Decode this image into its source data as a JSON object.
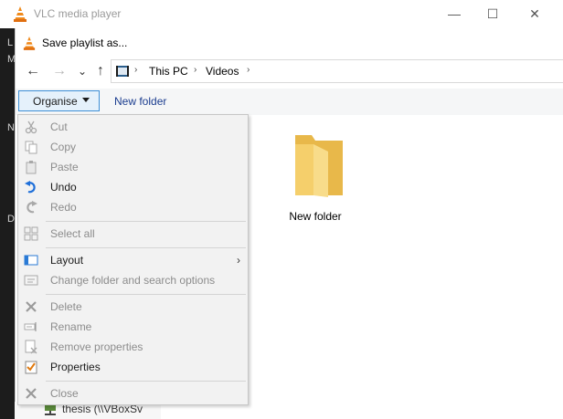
{
  "vlc": {
    "title": "VLC media player",
    "controls": {
      "minimize": "—",
      "maximize": "☐",
      "close": "✕"
    },
    "left_fragments": [
      "L",
      "M",
      "N",
      "D"
    ],
    "tree_item": "thesis (\\\\VBoxSv"
  },
  "dialog": {
    "title": "Save playlist as...",
    "nav": {
      "back": "←",
      "forward": "→",
      "recent": "⌄",
      "up": "↑"
    },
    "breadcrumb": {
      "sep": "›",
      "items": [
        "This PC",
        "Videos"
      ]
    },
    "toolbar": {
      "organise_label": "Organise",
      "new_folder_label": "New folder"
    },
    "folder_label": "New folder"
  },
  "menu": {
    "items": [
      {
        "label": "Cut",
        "enabled": false,
        "icon": "cut-icon"
      },
      {
        "label": "Copy",
        "enabled": false,
        "icon": "copy-icon"
      },
      {
        "label": "Paste",
        "enabled": false,
        "icon": "paste-icon"
      },
      {
        "label": "Undo",
        "enabled": true,
        "icon": "undo-icon"
      },
      {
        "label": "Redo",
        "enabled": false,
        "icon": "redo-icon"
      },
      {
        "label": "Select all",
        "enabled": false,
        "icon": "select-all-icon"
      },
      {
        "label": "Layout",
        "enabled": true,
        "icon": "layout-icon",
        "submenu": true
      },
      {
        "label": "Change folder and search options",
        "enabled": false,
        "icon": "options-icon"
      },
      {
        "label": "Delete",
        "enabled": false,
        "icon": "delete-icon"
      },
      {
        "label": "Rename",
        "enabled": false,
        "icon": "rename-icon"
      },
      {
        "label": "Remove properties",
        "enabled": false,
        "icon": "remove-properties-icon"
      },
      {
        "label": "Properties",
        "enabled": true,
        "icon": "properties-icon"
      },
      {
        "label": "Close",
        "enabled": false,
        "icon": "close-icon"
      }
    ],
    "submenu_arrow": "›"
  },
  "colors": {
    "accent": "#3c8fd6",
    "folder": "#f5cf6b",
    "link": "#1a3c8f"
  }
}
